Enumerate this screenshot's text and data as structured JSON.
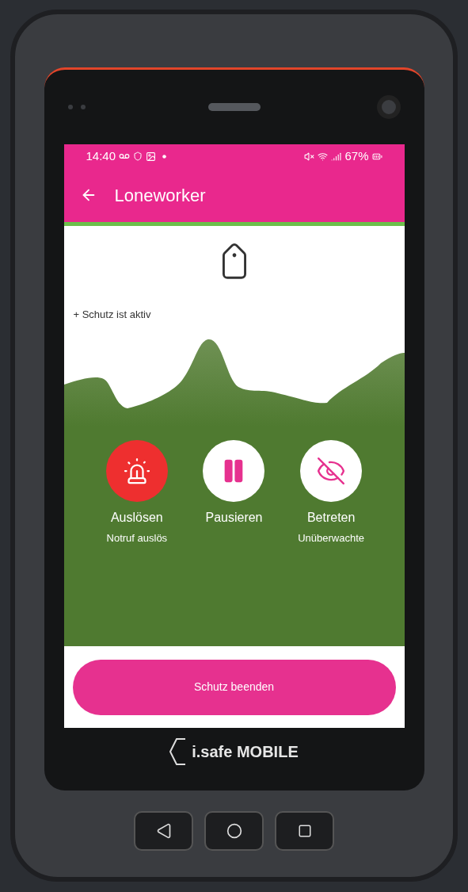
{
  "status_bar": {
    "time": "14:40",
    "battery": "67%"
  },
  "app_bar": {
    "title": "Loneworker"
  },
  "status_text": "+ Schutz ist aktiv",
  "actions": [
    {
      "kind": "alarm",
      "label": "Auslösen",
      "sublabel": "Notruf auslös"
    },
    {
      "kind": "pause",
      "label": "Pausieren"
    },
    {
      "kind": "hide",
      "label": "Betreten",
      "sublabel": "Unüberwachte"
    }
  ],
  "end_button": "Schutz beenden",
  "device": {
    "brand": "i.safe MOBILE"
  }
}
